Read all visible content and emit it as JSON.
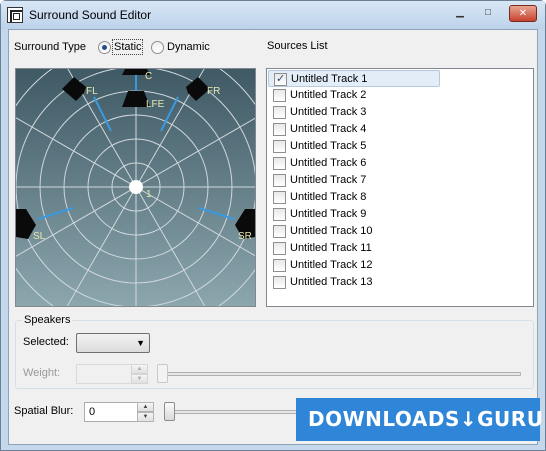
{
  "window": {
    "title": "Surround Sound Editor",
    "icon": "app-icon"
  },
  "surround": {
    "type_label": "Surround Type",
    "options": [
      {
        "label": "Static",
        "selected": true
      },
      {
        "label": "Dynamic",
        "selected": false
      }
    ]
  },
  "speaker_field": {
    "labels": {
      "c": "C",
      "fl": "FL",
      "fr": "FR",
      "lfe": "LFE",
      "sl": "SL",
      "sr": "SR",
      "source": "1"
    }
  },
  "sources": {
    "label": "Sources List",
    "items": [
      {
        "label": "Untitled Track  1",
        "checked": true,
        "selected": true
      },
      {
        "label": "Untitled Track  2",
        "checked": false
      },
      {
        "label": "Untitled Track  3",
        "checked": false
      },
      {
        "label": "Untitled Track  4",
        "checked": false
      },
      {
        "label": "Untitled Track  5",
        "checked": false
      },
      {
        "label": "Untitled Track  6",
        "checked": false
      },
      {
        "label": "Untitled Track  7",
        "checked": false
      },
      {
        "label": "Untitled Track  8",
        "checked": false
      },
      {
        "label": "Untitled Track  9",
        "checked": false
      },
      {
        "label": "Untitled Track  10",
        "checked": false
      },
      {
        "label": "Untitled Track  11",
        "checked": false
      },
      {
        "label": "Untitled Track  12",
        "checked": false
      },
      {
        "label": "Untitled Track  13",
        "checked": false
      }
    ]
  },
  "speakers": {
    "group_label": "Speakers",
    "selected_label": "Selected:",
    "selected_value": "",
    "weight_label": "Weight:",
    "weight_value": ""
  },
  "spatial_blur": {
    "label": "Spatial Blur:",
    "value": "0"
  },
  "watermark": {
    "text": "DOWNLOADS↓GURU"
  },
  "colors": {
    "field_bg": "#4b6571",
    "ring": "#d0d8dc",
    "speaker_line": "#3a9ae0",
    "watermark_bg": "#2f86d8"
  }
}
